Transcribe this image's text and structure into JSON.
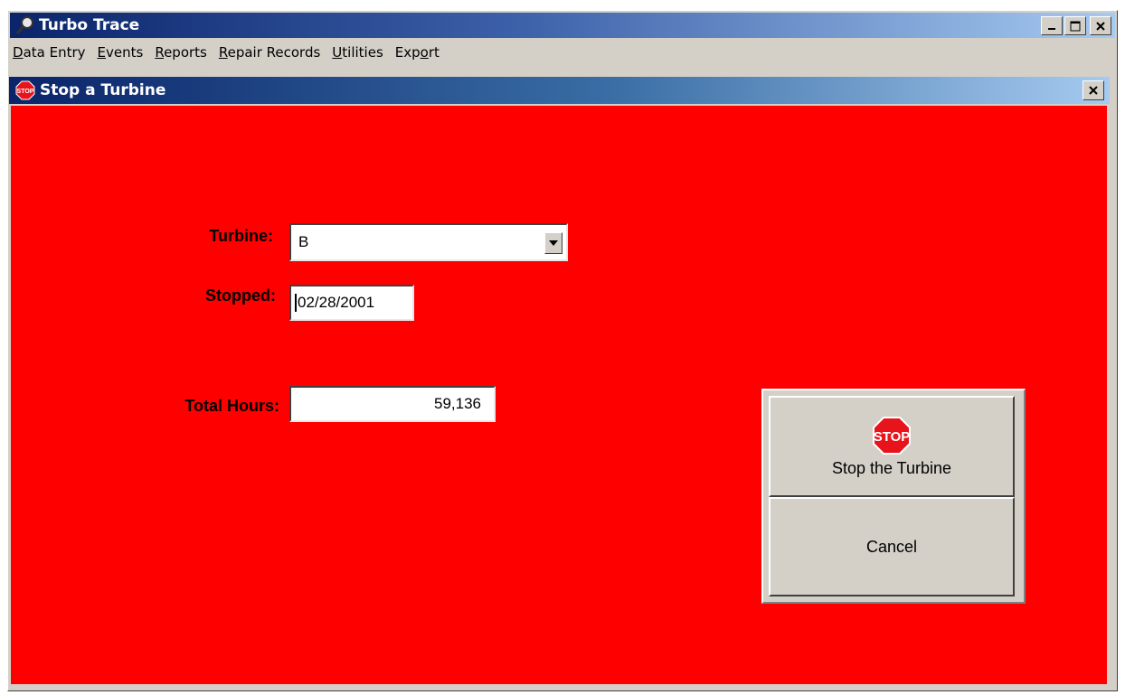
{
  "app": {
    "title": "Turbo Trace"
  },
  "menu": [
    "Data Entry",
    "Events",
    "Reports",
    "Repair Records",
    "Utilities",
    "Export"
  ],
  "menu_underlines": [
    "D",
    "E",
    "R",
    "R",
    "U",
    "o"
  ],
  "dialog": {
    "title": "Stop a Turbine",
    "icon_text": "STOP"
  },
  "form": {
    "turbine_label": "Turbine:",
    "turbine_value": "B",
    "stopped_label": "Stopped:",
    "stopped_value": "02/28/2001",
    "hours_label": "Total Hours:",
    "hours_value": "59,136"
  },
  "buttons": {
    "stop_icon_text": "STOP",
    "stop_label": "Stop the Turbine",
    "cancel_label": "Cancel"
  },
  "colors": {
    "form_background": "#ff0000",
    "titlebar": "#0a246a",
    "stop_sign": "#e8141c"
  }
}
